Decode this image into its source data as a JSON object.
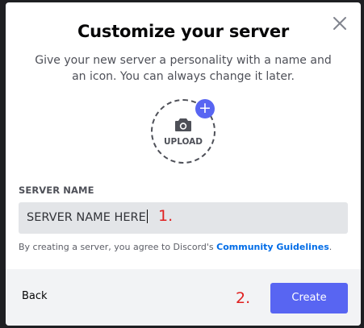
{
  "dialog": {
    "title": "Customize your server",
    "subtitle": "Give your new server a personality with a name and an icon. You can always change it later.",
    "close_icon": "close-icon"
  },
  "upload": {
    "label": "UPLOAD",
    "camera_icon": "camera-icon",
    "plus_icon": "plus-icon",
    "plus_glyph": "+"
  },
  "server_name": {
    "label": "SERVER NAME",
    "value": "SERVER NAME HERE"
  },
  "annotations": {
    "step1": "1.",
    "step2": "2."
  },
  "terms": {
    "prefix": "By creating a server, you agree to Discord's ",
    "link": "Community Guidelines",
    "suffix": "."
  },
  "footer": {
    "back_label": "Back",
    "create_label": "Create"
  },
  "colors": {
    "accent": "#5865f2",
    "link": "#006ce7",
    "annotation": "#e02020"
  }
}
